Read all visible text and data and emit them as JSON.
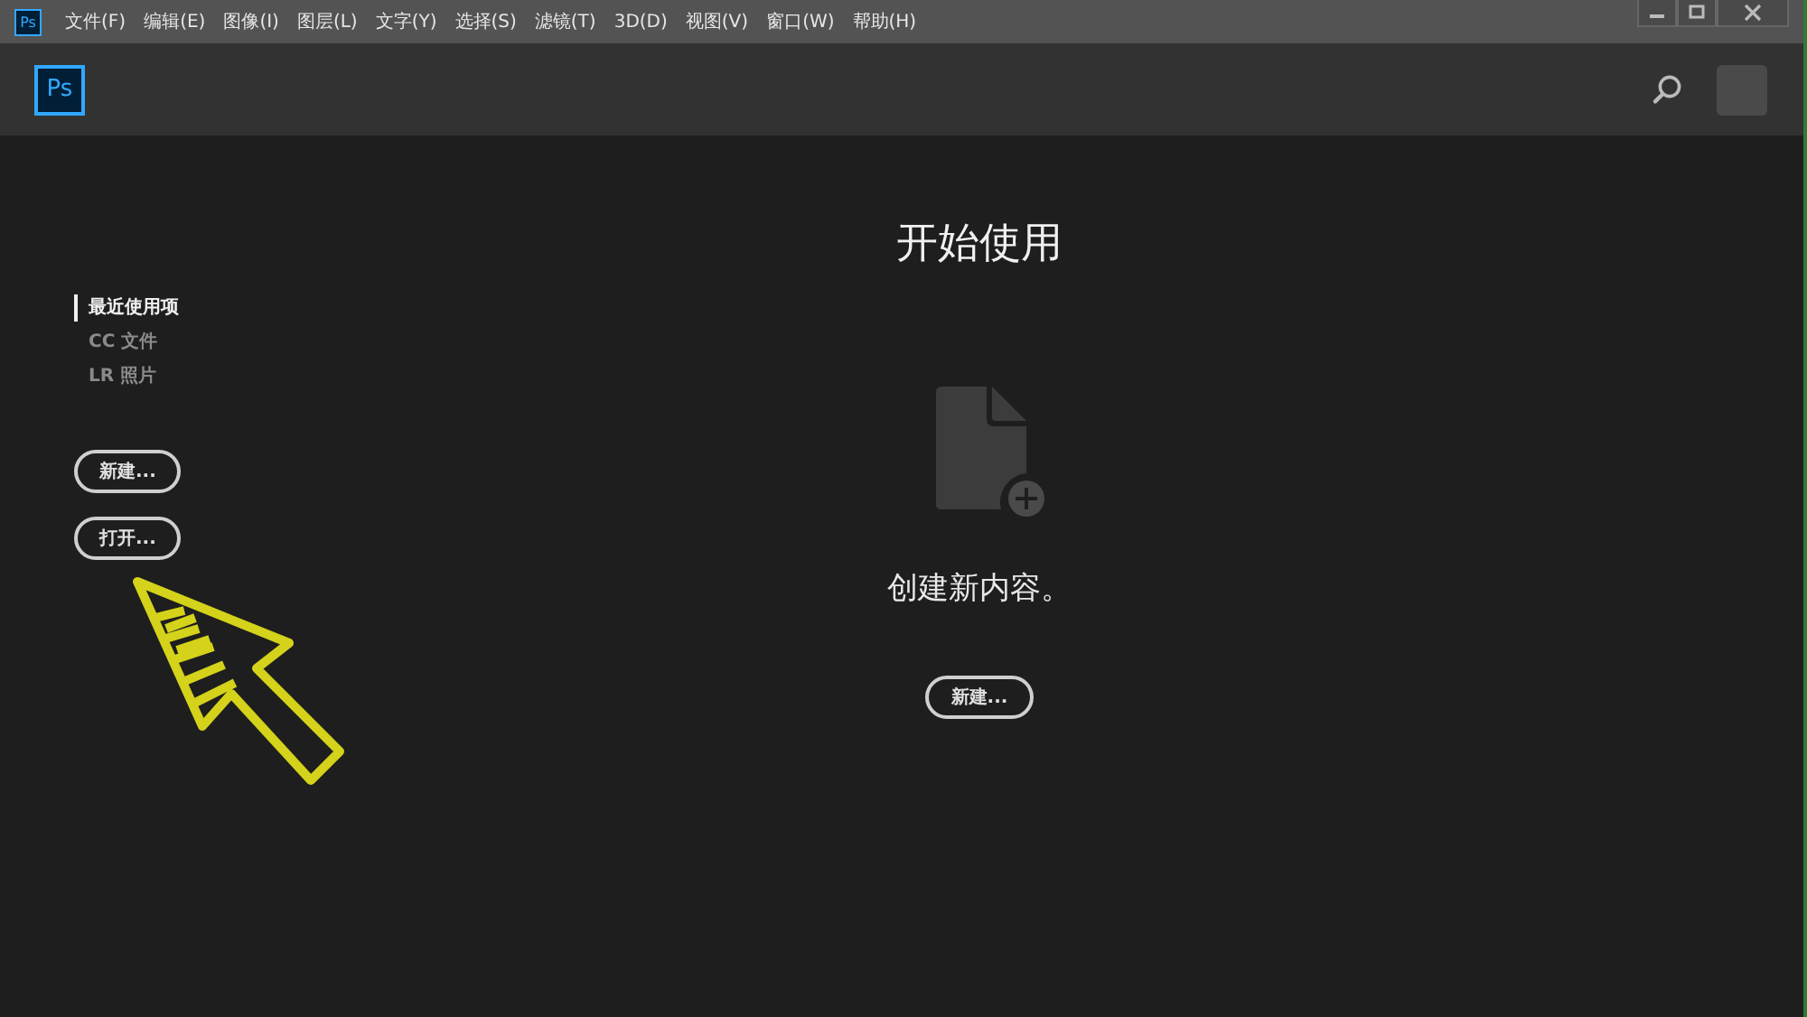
{
  "menu_bar": {
    "app_icon": "Ps",
    "items": [
      "文件(F)",
      "编辑(E)",
      "图像(I)",
      "图层(L)",
      "文字(Y)",
      "选择(S)",
      "滤镜(T)",
      "3D(D)",
      "视图(V)",
      "窗口(W)",
      "帮助(H)"
    ]
  },
  "header": {
    "logo": "Ps"
  },
  "sidebar": {
    "items": [
      {
        "label": "最近使用项",
        "selected": true
      },
      {
        "label": "CC 文件",
        "selected": false
      },
      {
        "label": "LR 照片",
        "selected": false
      }
    ],
    "buttons": [
      "新建...",
      "打开..."
    ]
  },
  "main": {
    "title": "开始使用",
    "message": "创建新内容。",
    "button": "新建..."
  }
}
